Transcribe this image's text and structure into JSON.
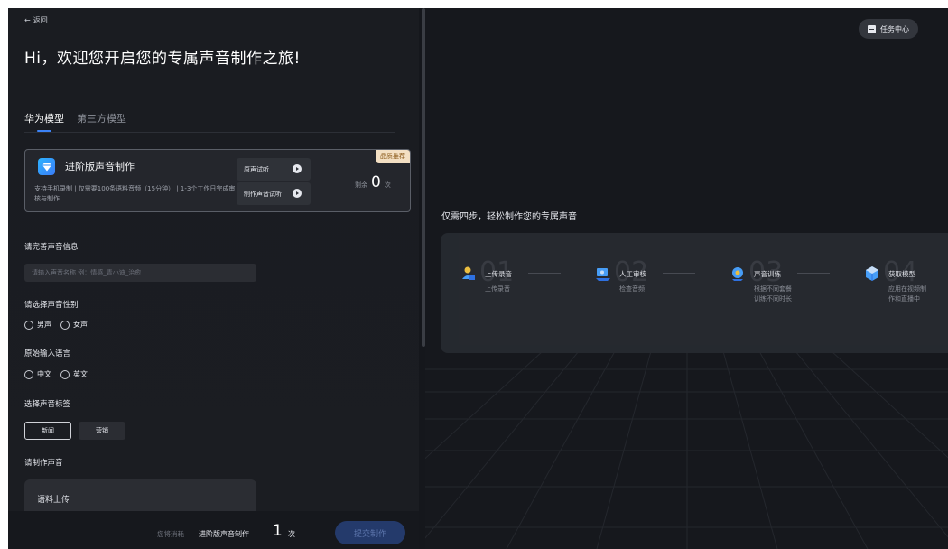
{
  "nav": {
    "back_label": "返回"
  },
  "page_title": "Hi，欢迎您开启您的专属声音制作之旅!",
  "tabs": [
    {
      "label": "华为模型",
      "active": true
    },
    {
      "label": "第三方模型",
      "active": false
    }
  ],
  "card": {
    "title": "进阶版声音制作",
    "description": "支持手机录制 | 仅需要100条语料音频（15分钟） | 1-3个工作日完成审核与制作",
    "btn_original": "原声试听",
    "btn_make": "制作声音试听",
    "remain_prefix": "剩余",
    "remain_count": "0",
    "remain_unit": "次",
    "badge": "品质推荐"
  },
  "form": {
    "name_label": "请完善声音信息",
    "name_placeholder": "请输入声音名称 例：情感_青小迪_治愈",
    "gender_label": "请选择声音性别",
    "gender_options": [
      "男声",
      "女声"
    ],
    "lang_label": "原始输入语言",
    "lang_options": [
      "中文",
      "英文"
    ],
    "tag_label": "选择声音标签",
    "tags": [
      {
        "label": "新闻",
        "selected": true
      },
      {
        "label": "营销",
        "selected": false
      }
    ],
    "make_label": "请制作声音",
    "upload_label": "语料上传"
  },
  "footer": {
    "cost_prefix": "您将消耗",
    "cost_item": "进阶版声音制作",
    "cost_count": "1",
    "cost_unit": "次",
    "submit_label": "提交制作"
  },
  "right": {
    "task_center": "任务中心",
    "steps_title": "仅需四步，轻松制作您的专属声音",
    "steps": [
      {
        "no": "01",
        "name": "上传录音",
        "sub": [
          "上传录音"
        ],
        "icon": "user-upload-icon"
      },
      {
        "no": "02",
        "name": "人工审核",
        "sub": [
          "检查音频"
        ],
        "icon": "review-icon"
      },
      {
        "no": "03",
        "name": "声音训练",
        "sub": [
          "根据不同套餐",
          "训练不同时长"
        ],
        "icon": "training-icon"
      },
      {
        "no": "04",
        "name": "获取模型",
        "sub": [
          "应用在视频制",
          "作和直播中"
        ],
        "icon": "model-icon"
      }
    ]
  }
}
